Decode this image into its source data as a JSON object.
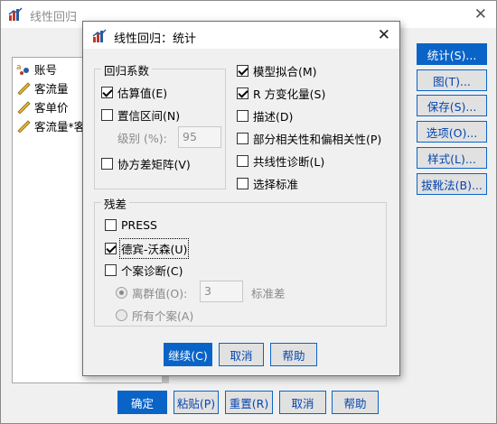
{
  "main_window": {
    "title": "线性回归",
    "variables": [
      "账号",
      "客流量",
      "客单价",
      "客流量*客"
    ],
    "side_buttons": {
      "statistics": "统计(S)...",
      "plots": "图(T)...",
      "save": "保存(S)...",
      "options": "选项(O)...",
      "style": "样式(L)...",
      "bootstrap": "拔靴法(B)..."
    },
    "bottom_buttons": {
      "ok": "确定",
      "paste": "粘贴(P)",
      "reset": "重置(R)",
      "cancel": "取消",
      "help": "帮助"
    }
  },
  "dialog": {
    "title": "线性回归：统计",
    "regression_coefficients": {
      "legend": "回归系数",
      "estimates": {
        "label": "估算值(E)",
        "checked": true
      },
      "confidence_intervals": {
        "label": "置信区间(N)",
        "checked": false
      },
      "level_label": "级别 (%):",
      "level_value": "95",
      "covariance_matrix": {
        "label": "协方差矩阵(V)",
        "checked": false
      }
    },
    "right_options": {
      "model_fit": {
        "label": "模型拟合(M)",
        "checked": true
      },
      "r_squared_change": {
        "label": "R 方变化量(S)",
        "checked": true
      },
      "descriptives": {
        "label": "描述(D)",
        "checked": false
      },
      "part_partial": {
        "label": "部分相关性和偏相关性(P)",
        "checked": false
      },
      "collinearity": {
        "label": "共线性诊断(L)",
        "checked": false
      },
      "selection_criteria": {
        "label": "选择标准",
        "checked": false
      }
    },
    "residuals": {
      "legend": "残差",
      "press": {
        "label": "PRESS",
        "checked": false
      },
      "durbin_watson": {
        "label": "德宾-沃森(U)",
        "checked": true
      },
      "casewise": {
        "label": "个案诊断(C)",
        "checked": false
      },
      "outliers": {
        "label": "离群值(O):",
        "selected": true
      },
      "outliers_value": "3",
      "outliers_unit": "标准差",
      "all_cases": {
        "label": "所有个案(A)",
        "selected": false
      }
    },
    "buttons": {
      "continue": "继续(C)",
      "cancel": "取消",
      "help": "帮助"
    }
  },
  "colors": {
    "accent": "#0a64c8",
    "link_text": "#0645ad",
    "background": "#f0f0f0"
  }
}
